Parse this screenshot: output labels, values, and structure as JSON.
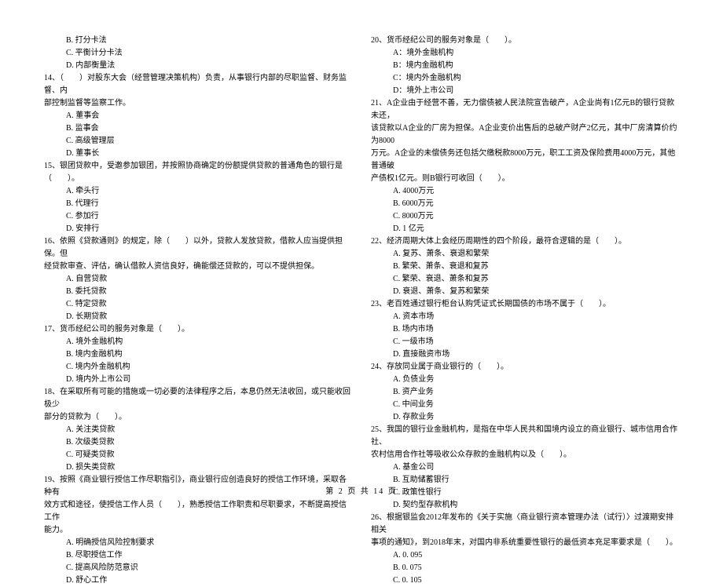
{
  "footer": "第 2 页 共 14 页",
  "left": {
    "pre_options": [
      "B. 打分卡法",
      "C. 平衡计分卡法",
      "D. 内部衡量法"
    ],
    "questions": [
      {
        "num": "14",
        "stem": [
          "14、（　　）对股东大会（经营管理决策机构）负责，从事银行内部的尽职监督、财务监督、内",
          "部控制监督等监察工作。"
        ],
        "options": [
          "A. 董事会",
          "B. 监事会",
          "C. 高级管理层",
          "D. 董事长"
        ]
      },
      {
        "num": "15",
        "stem": [
          "15、银团贷款中，受邀参加银团，并按照协商确定的份额提供贷款的普通角色的银行是",
          "（　　）。"
        ],
        "options": [
          "A. 牵头行",
          "B. 代理行",
          "C. 参加行",
          "D. 安排行"
        ]
      },
      {
        "num": "16",
        "stem": [
          "16、依照《贷款通则》的规定，除（　　）以外，贷款人发放贷款，借款人应当提供担保。但",
          "经贷款审查、评估，确认借款人资信良好，确能偿还贷款的，可以不提供担保。"
        ],
        "options": [
          "A. 自营贷款",
          "B. 委托贷款",
          "C. 特定贷款",
          "D. 长期贷款"
        ]
      },
      {
        "num": "17",
        "stem": [
          "17、货币经纪公司的服务对象是（　　）。"
        ],
        "options": [
          "A. 境外金融机构",
          "B. 境内金融机构",
          "C. 境内外金融机构",
          "D. 境内外上市公司"
        ]
      },
      {
        "num": "18",
        "stem": [
          "18、在采取所有可能的措施或一切必要的法律程序之后，本息仍然无法收回，或只能收回极少",
          "部分的贷款为（　　）。"
        ],
        "options": [
          "A. 关注类贷款",
          "B. 次级类贷款",
          "C. 可疑类贷款",
          "D. 损失类贷款"
        ]
      },
      {
        "num": "19",
        "stem": [
          "19、按照《商业银行授信工作尽职指引》，商业银行应创造良好的授信工作环境，采取各种有",
          "效方式和途径，使授信工作人员（　　），熟悉授信工作职责和尽职要求，不断提高授信工作",
          "能力。"
        ],
        "options": [
          "A. 明确授信风险控制要求",
          "B. 尽职授信工作",
          "C. 提高风险防范意识",
          "D. 舒心工作"
        ]
      }
    ]
  },
  "right": {
    "questions": [
      {
        "num": "20",
        "stem": [
          "20、货币经纪公司的服务对象是（　　）。"
        ],
        "options": [
          "A：境外金融机构",
          "B：境内金融机构",
          "C：境内外金融机构",
          "D：境外上市公司"
        ]
      },
      {
        "num": "21",
        "stem": [
          "21、A企业由于经营不善，无力偿债被人民法院宣告破产，A企业尚有1亿元B的银行贷款未还，",
          "该贷款以A企业的厂房为担保。A企业变价出售后的总破产财产2亿元，其中厂房清算价约为8000",
          "万元。A企业的未偿债务还包括欠缴税款8000万元，职工工资及保险费用4000万元，其他普通破",
          "产债权1亿元。则B银行可收回（　　）。"
        ],
        "options": [
          "A. 4000万元",
          "B. 6000万元",
          "C. 8000万元",
          "D. 1 亿元"
        ]
      },
      {
        "num": "22",
        "stem": [
          "22、经济周期大体上会经历周期性的四个阶段，最符合逻辑的是（　　）。"
        ],
        "options": [
          "A. 复苏、萧条、衰退和繁荣",
          "B. 繁荣、萧条、衰退和复苏",
          "C. 繁荣、衰退、萧条和复苏",
          "D. 衰退、萧条、复苏和繁荣"
        ]
      },
      {
        "num": "23",
        "stem": [
          "23、老百姓通过银行柜台认购凭证式长期国债的市场不属于（　　）。"
        ],
        "options": [
          "A. 资本市场",
          "B. 场内市场",
          "C. 一级市场",
          "D. 直接融资市场"
        ]
      },
      {
        "num": "24",
        "stem": [
          "24、存放同业属于商业银行的（　　）。"
        ],
        "options": [
          "A. 负债业务",
          "B. 资产业务",
          "C. 中间业务",
          "D. 存款业务"
        ]
      },
      {
        "num": "25",
        "stem": [
          "25、我国的银行业金融机构，是指在中华人民共和国境内设立的商业银行、城市信用合作社、",
          "农村信用合作社等吸收公众存款的金融机构以及（　　）。"
        ],
        "options": [
          "A. 基金公司",
          "B. 互助储蓄银行",
          "C. 政策性银行",
          "D. 契约型存款机构"
        ]
      },
      {
        "num": "26",
        "stem": [
          "26、根据银监会2012年发布的《关于实施〈商业银行资本管理办法（试行）〉过渡期安排相关",
          "事项的通知》，到2018年末，对国内非系统重要性银行的最低资本充足率要求是（　　）。"
        ],
        "options": [
          "A. 0. 095",
          "B. 0. 075",
          "C. 0. 105"
        ]
      }
    ]
  }
}
